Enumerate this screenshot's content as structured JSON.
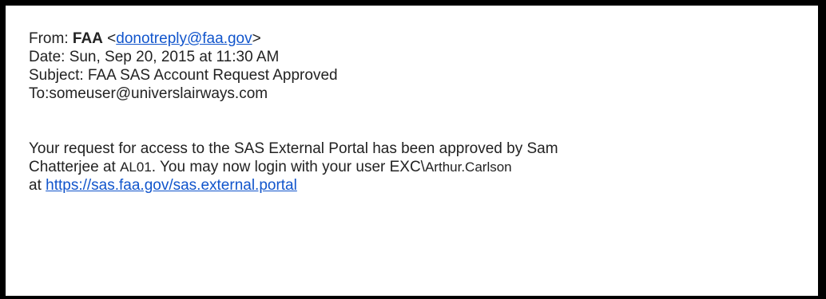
{
  "email": {
    "from_label": "From: ",
    "from_name": "FAA",
    "from_addr_open": " <",
    "from_addr": "donotreply@faa.gov",
    "from_addr_close": ">",
    "date": "Date: Sun, Sep 20, 2015 at 11:30 AM",
    "subject": "Subject: FAA SAS Account Request Approved",
    "to": "To:someuser@universlairways.com",
    "body_line1": "Your request for access to the SAS External Portal has been approved by Sam",
    "body_line2_a": "Chatterjee at ",
    "body_line2_code": "AL01",
    "body_line2_b": ". You may now login with your user EXC\\",
    "body_line2_user": "Arthur.Carlson",
    "body_line3_a": "at ",
    "portal_link": "https://sas.faa.gov/sas.external.portal"
  }
}
